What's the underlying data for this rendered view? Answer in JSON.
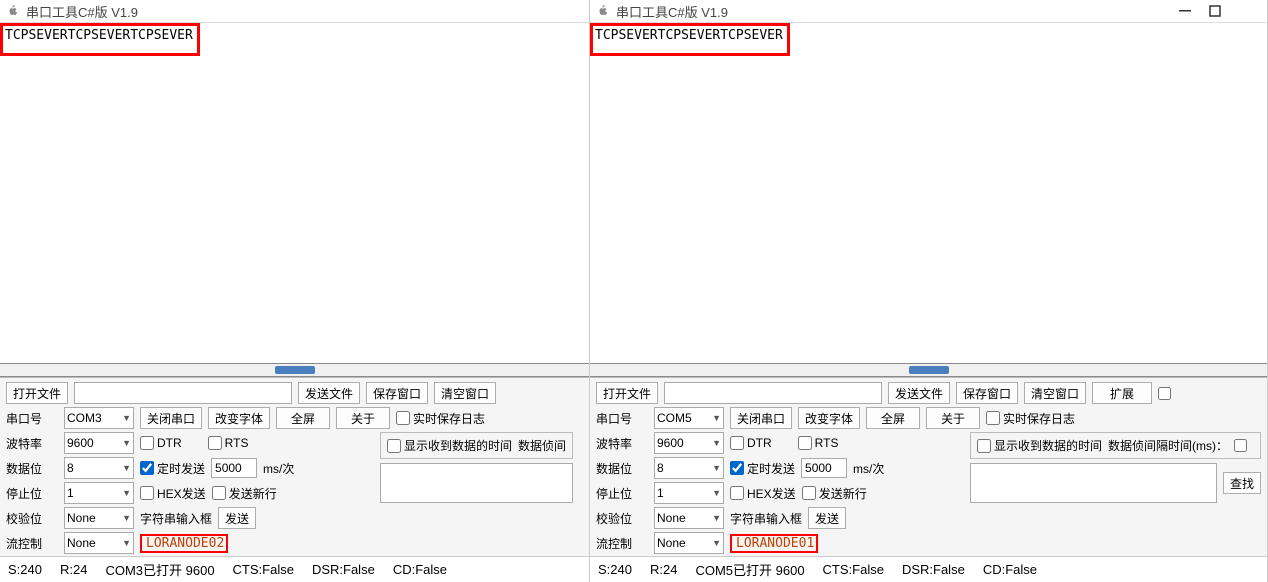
{
  "left": {
    "title": "串口工具C#版  V1.9",
    "received_text": "TCPSEVERTCPSEVERTCPSEVER",
    "open_file": "打开文件",
    "send_file": "发送文件",
    "save_window": "保存窗口",
    "clear_window": "清空窗口",
    "port_lbl": "串口号",
    "port_val": "COM3",
    "close_port": "关闭串口",
    "change_font": "改变字体",
    "fullscreen": "全屏",
    "about": "关于",
    "realtime_save": "实时保存日志",
    "baud_lbl": "波特率",
    "baud_val": "9600",
    "dtr": "DTR",
    "rts": "RTS",
    "data_lbl": "数据位",
    "data_val": "8",
    "timed_send": "定时发送",
    "interval_val": "5000",
    "interval_unit": "ms/次",
    "show_recv_time": "显示收到数据的时间",
    "recv_interval_lbl": "数据侦间",
    "stop_lbl": "停止位",
    "stop_val": "1",
    "hex_send": "HEX发送",
    "send_newline": "发送新行",
    "parity_lbl": "校验位",
    "parity_val": "None",
    "str_input_lbl": "字符串输入框",
    "send": "发送",
    "flow_lbl": "流控制",
    "flow_val": "None",
    "node_text": "LORANODE02",
    "status_s": "S:240",
    "status_r": "R:24",
    "status_port": "COM3已打开  9600",
    "status_cts": "CTS:False",
    "status_dsr": "DSR:False",
    "status_cd": "CD:False"
  },
  "right": {
    "title": "串口工具C#版  V1.9",
    "received_text": "TCPSEVERTCPSEVERTCPSEVER",
    "open_file": "打开文件",
    "send_file": "发送文件",
    "save_window": "保存窗口",
    "clear_window": "清空窗口",
    "expand": "扩展",
    "port_lbl": "串口号",
    "port_val": "COM5",
    "close_port": "关闭串口",
    "change_font": "改变字体",
    "fullscreen": "全屏",
    "about": "关于",
    "realtime_save": "实时保存日志",
    "baud_lbl": "波特率",
    "baud_val": "9600",
    "dtr": "DTR",
    "rts": "RTS",
    "data_lbl": "数据位",
    "data_val": "8",
    "timed_send": "定时发送",
    "interval_val": "5000",
    "interval_unit": "ms/次",
    "show_recv_time": "显示收到数据的时间",
    "recv_interval_lbl": "数据侦间隔时间(ms)：",
    "stop_lbl": "停止位",
    "stop_val": "1",
    "hex_send": "HEX发送",
    "send_newline": "发送新行",
    "find_btn": "查找",
    "parity_lbl": "校验位",
    "parity_val": "None",
    "str_input_lbl": "字符串输入框",
    "send": "发送",
    "flow_lbl": "流控制",
    "flow_val": "None",
    "node_text": "LORANODE01",
    "status_s": "S:240",
    "status_r": "R:24",
    "status_port": "COM5已打开  9600",
    "status_cts": "CTS:False",
    "status_dsr": "DSR:False",
    "status_cd": "CD:False"
  }
}
